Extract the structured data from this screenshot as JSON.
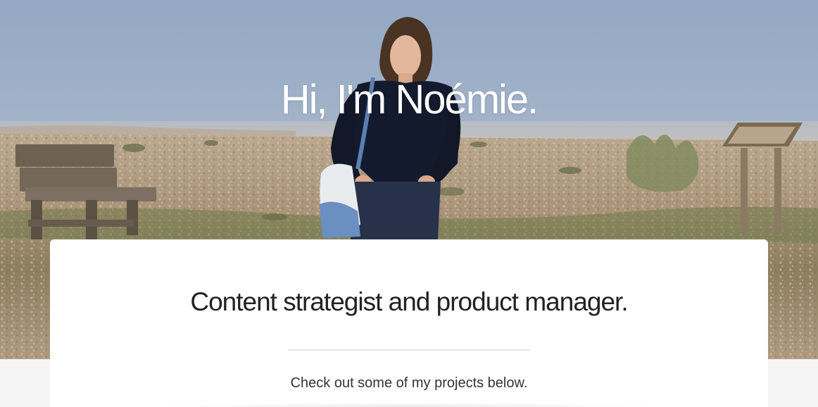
{
  "hero": {
    "title": "Hi, I'm Noémie."
  },
  "intro": {
    "headline": "Content strategist and product manager.",
    "subtext": "Check out some of my projects below."
  },
  "colors": {
    "sky": "#9fb1c9",
    "card_background": "#ffffff",
    "page_background": "#f5f5f5",
    "headline_text": "#222222",
    "divider": "#e3e3e3"
  }
}
